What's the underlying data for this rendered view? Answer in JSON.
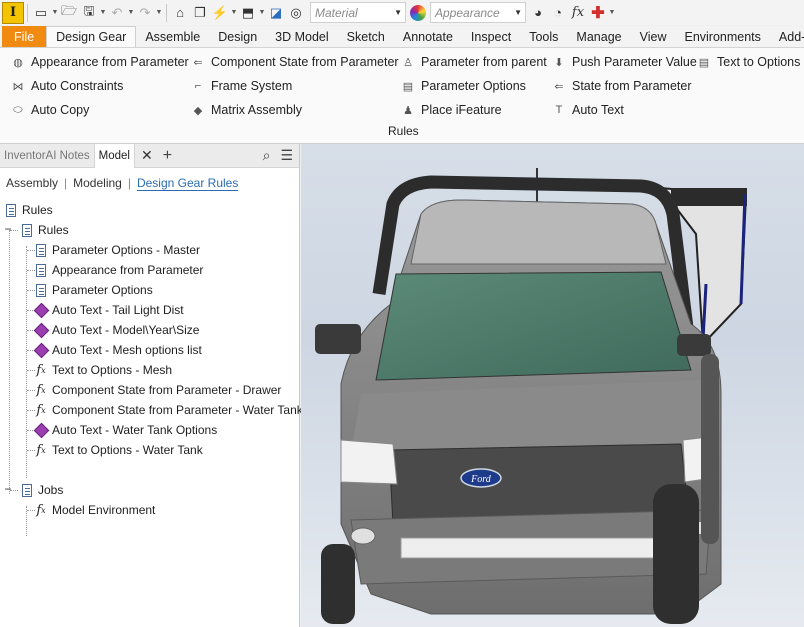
{
  "qat": {
    "app_logo": "I",
    "material_placeholder": "Material",
    "appearance_placeholder": "Appearance"
  },
  "tabs": [
    "File",
    "Design Gear",
    "Assemble",
    "Design",
    "3D Model",
    "Sketch",
    "Annotate",
    "Inspect",
    "Tools",
    "Manage",
    "View",
    "Environments",
    "Add-In"
  ],
  "ribbon": {
    "col1": [
      "Appearance from Parameter",
      "Auto Constraints",
      "Auto Copy"
    ],
    "col2": [
      "Component State from Parameter",
      "Frame System",
      "Matrix Assembly"
    ],
    "col3": [
      "Parameter from parent",
      "Parameter Options",
      "Place iFeature"
    ],
    "col4": [
      "Push Parameter Value",
      "State from Parameter",
      "Auto Text"
    ],
    "col5": [
      "Text to Options"
    ],
    "panel_title": "Rules"
  },
  "browser": {
    "tabs": [
      "InventorAI Notes",
      "Model"
    ],
    "filters": [
      "Assembly",
      "Modeling",
      "Design Gear Rules"
    ],
    "tree": {
      "root": "Rules",
      "rules_group": "Rules",
      "rules": [
        {
          "label": "Parameter Options - Master",
          "icon": "doc"
        },
        {
          "label": "Appearance from Parameter",
          "icon": "doc"
        },
        {
          "label": "Parameter Options",
          "icon": "doc"
        },
        {
          "label": "Auto Text - Tail Light Dist",
          "icon": "diamond"
        },
        {
          "label": "Auto Text - Model\\Year\\Size",
          "icon": "diamond"
        },
        {
          "label": "Auto Text - Mesh options list",
          "icon": "diamond"
        },
        {
          "label": "Text to Options - Mesh",
          "icon": "fx"
        },
        {
          "label": "Component State from Parameter - Drawer",
          "icon": "fx"
        },
        {
          "label": "Component State from Parameter - Water Tank",
          "icon": "fx"
        },
        {
          "label": "Auto Text - Water Tank Options",
          "icon": "diamond"
        },
        {
          "label": "Text to Options - Water Tank",
          "icon": "fx"
        }
      ],
      "jobs_group": "Jobs",
      "jobs": [
        {
          "label": "Model Environment",
          "icon": "fx"
        }
      ]
    }
  },
  "viewport": {
    "badge_text": "Ford"
  }
}
